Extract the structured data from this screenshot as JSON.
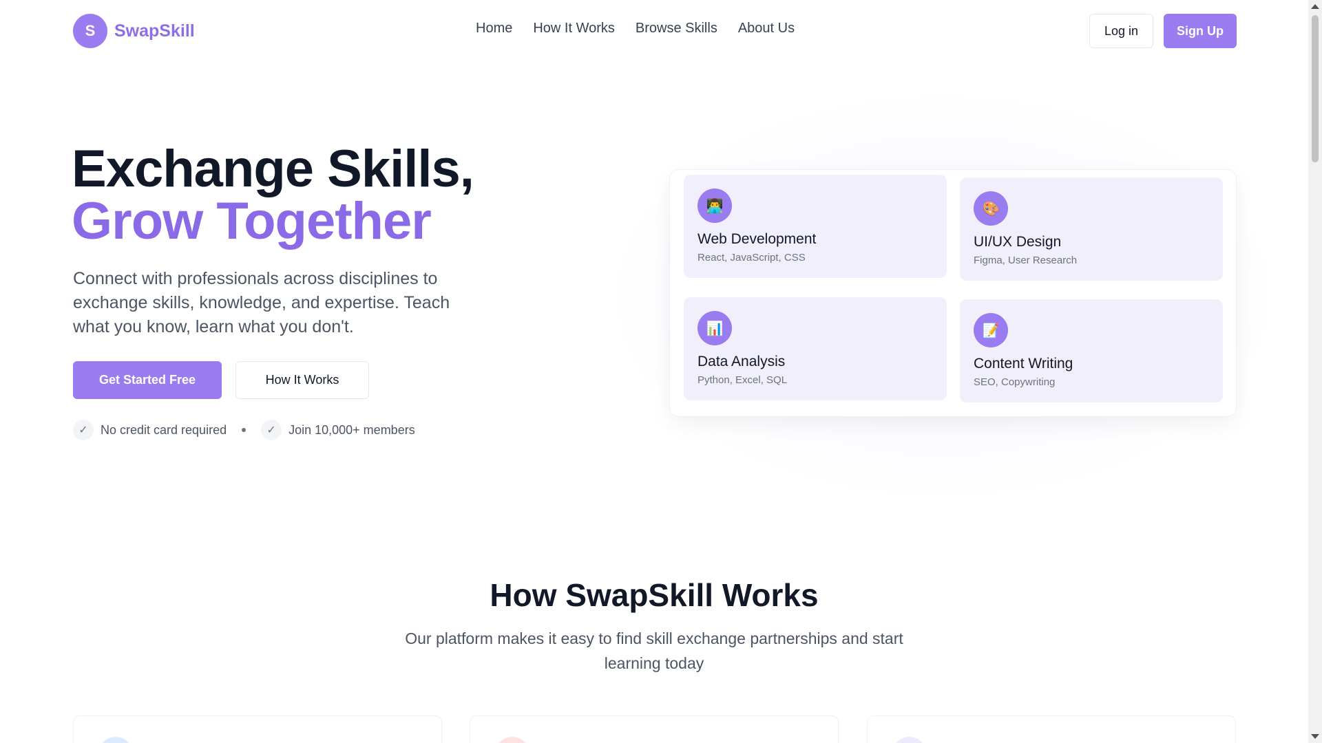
{
  "brand": {
    "initial": "S",
    "name": "SwapSkill"
  },
  "nav": [
    {
      "label": "Home"
    },
    {
      "label": "How It Works"
    },
    {
      "label": "Browse Skills"
    },
    {
      "label": "About Us"
    }
  ],
  "auth": {
    "login": "Log in",
    "signup": "Sign Up"
  },
  "hero": {
    "title_line1": "Exchange Skills,",
    "title_line2": "Grow Together",
    "description": "Connect with professionals across disciplines to exchange skills, knowledge, and expertise. Teach what you know, learn what you don't.",
    "primary_cta": "Get Started Free",
    "secondary_cta": "How It Works",
    "perks": [
      "No credit card required",
      "Join 10,000+ members"
    ],
    "check_glyph": "✓"
  },
  "skills": [
    {
      "name": "Web Development",
      "tags": "React, JavaScript, CSS",
      "icon": "👨‍💻",
      "icon_name": "developer-icon"
    },
    {
      "name": "UI/UX Design",
      "tags": "Figma, User Research",
      "icon": "🎨",
      "icon_name": "palette-icon"
    },
    {
      "name": "Data Analysis",
      "tags": "Python, Excel, SQL",
      "icon": "📊",
      "icon_name": "chart-icon"
    },
    {
      "name": "Content Writing",
      "tags": "SEO, Copywriting",
      "icon": "📝",
      "icon_name": "memo-icon"
    }
  ],
  "how_it_works": {
    "title": "How SwapSkill Works",
    "subtitle": "Our platform makes it easy to find skill exchange partnerships and start learning today"
  },
  "colors": {
    "accent": "#9b7bf0",
    "accent_text": "#8a6ae6",
    "card_bg": "#f2effc",
    "feature_circle_1": "#dbeafe",
    "feature_circle_2": "#fee2e2",
    "feature_circle_3": "#ede9fe"
  }
}
